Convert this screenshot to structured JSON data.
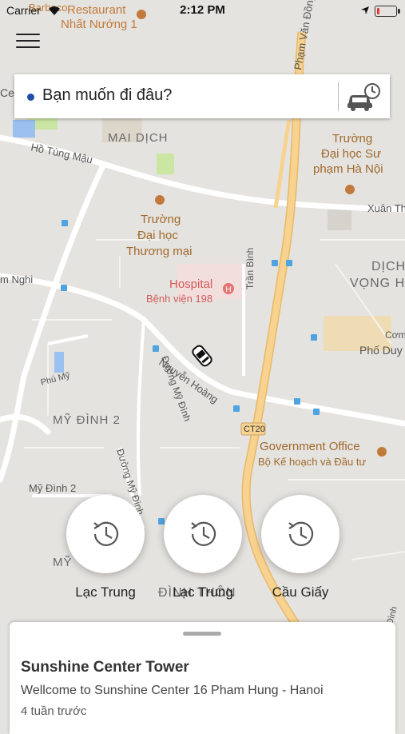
{
  "status_bar": {
    "carrier": "Carrier",
    "time": "2:12 PM",
    "battery_fraction": 0.15
  },
  "search": {
    "placeholder": "Bạn muốn đi đâu?"
  },
  "map": {
    "labels": {
      "restaurant_top": "Restaurant",
      "restaurant_name": "Nhất Nướng 1",
      "barbecue": "Barbeco",
      "pham_van_dong": "Phạm Văn Đồng",
      "mai_dich": "MAI DỊCH",
      "ho_tung_mau": "Hồ Tùng Mậu",
      "school_sp_1": "Trường",
      "school_sp_2": "Đại học Sư",
      "school_sp_3": "phạm Hà Nội",
      "xuan_thuy": "Xuân Th",
      "school_tm_1": "Trường",
      "school_tm_2": "Đại học",
      "school_tm_3": "Thương mại",
      "tran_binh": "Trần Bình",
      "hospital_1": "Hospital",
      "hospital_2": "Bệnh viện 198",
      "dich_vong_1": "DỊCH",
      "dich_vong_2": "VỌNG H",
      "nam_nghi": "m Nghi",
      "com": "Cơm",
      "pho_duy": "Phố Duy",
      "phu_my": "Phú Mỹ",
      "duong_my_dinh": "Đường Mỹ Đình",
      "nguyen_hoang": "Nguyễn Hoàng",
      "my_dinh_2": "MỸ ĐÌNH 2",
      "ct20": "CT20",
      "gov_1": "Government Office",
      "gov_2": "Bộ Kế hoạch và Đầu tư",
      "duong_my_dinh_2": "Đường Mỹ Đình",
      "my_dinh_2_street": "Mỹ Đình 2",
      "my_partial": "MỸ",
      "dinh_thon": "ĐÌNH THÔN",
      "dinh_partial": "Đình",
      "ce_partial": "Ce"
    },
    "colors": {
      "land": "#e5e3df",
      "road": "#ffffff",
      "highway": "#f5cf84",
      "park": "#cbe6a3",
      "water": "#9ac0f0",
      "poi": "#c17a3b",
      "hospital": "#e57373"
    }
  },
  "history_buttons": [
    {
      "label": "Lạc Trung",
      "icon": "history-icon"
    },
    {
      "label": "Lạc Trung",
      "icon": "history-icon"
    },
    {
      "label": "Cầu Giấy",
      "icon": "history-icon"
    }
  ],
  "card": {
    "title": "Sunshine Center Tower",
    "description": "Wellcome to Sunshine Center 16 Pham Hung - Hanoi",
    "time": "4 tuần trước"
  }
}
